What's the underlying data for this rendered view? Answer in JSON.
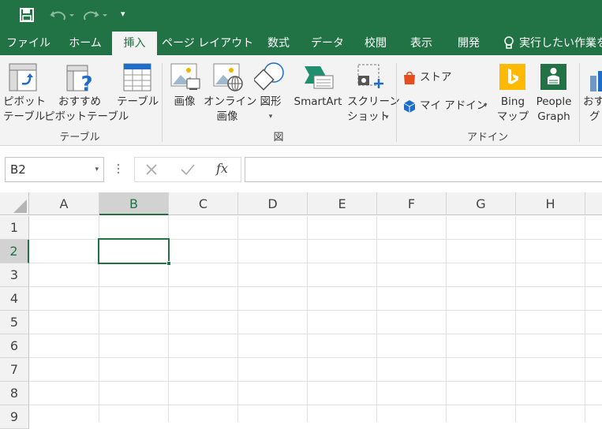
{
  "quick_access": {
    "save": "save",
    "undo": "undo",
    "redo": "redo",
    "customize": "▾"
  },
  "tabs": [
    "ファイル",
    "ホーム",
    "挿入",
    "ページ レイアウト",
    "数式",
    "データ",
    "校閲",
    "表示",
    "開発"
  ],
  "active_tab": "挿入",
  "tell_me": "実行したい作業を",
  "ribbon": {
    "table_group": {
      "label": "テーブル",
      "pivot": [
        "ピボット",
        "テーブル"
      ],
      "recommended_pivot": [
        "おすすめ",
        "ピボットテーブル"
      ],
      "table": "テーブル"
    },
    "illustrations_group": {
      "label": "図",
      "picture": "画像",
      "online_picture": [
        "オンライン",
        "画像"
      ],
      "shapes": "図形",
      "smartart": "SmartArt",
      "screenshot": [
        "スクリーン",
        "ショット"
      ]
    },
    "addins_group": {
      "label": "アドイン",
      "store": "ストア",
      "my_addins": "マイ アドイン",
      "bing_maps": [
        "Bing",
        "マップ"
      ],
      "people_graph": [
        "People",
        "Graph"
      ],
      "recommended_chart": [
        "おす",
        "グ"
      ]
    }
  },
  "formula_bar": {
    "name_box": "B2",
    "fx": "fx",
    "formula": ""
  },
  "columns": [
    "A",
    "B",
    "C",
    "D",
    "E",
    "F",
    "G",
    "H"
  ],
  "rows": [
    "1",
    "2",
    "3",
    "4",
    "5",
    "6",
    "7",
    "8",
    "9"
  ],
  "selected_cell": "B2",
  "colors": {
    "accent": "#217346",
    "ribbon_bg": "#f3f3f3",
    "bing": "#ffb900",
    "people_graph": "#217346",
    "store": "#e74c1c",
    "addin": "#1e6dc8"
  }
}
